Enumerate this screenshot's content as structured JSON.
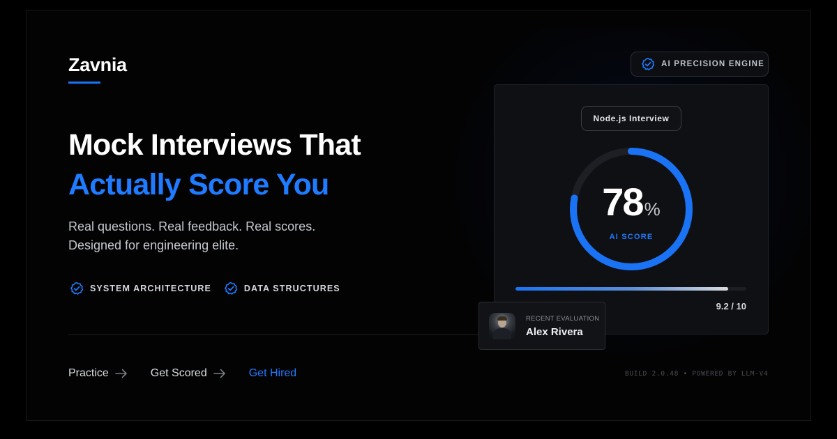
{
  "brand": {
    "name": "Zavnia",
    "accent_color": "#1f7bff"
  },
  "hero": {
    "headline_line1": "Mock Interviews That",
    "headline_line2": "Actually Score You",
    "subtitle_line1": "Real questions. Real feedback. Real scores.",
    "subtitle_line2": "Designed for engineering elite."
  },
  "tags": [
    {
      "label": "SYSTEM ARCHITECTURE",
      "icon": "check-badge-icon"
    },
    {
      "label": "DATA STRUCTURES",
      "icon": "check-badge-icon"
    }
  ],
  "steps": [
    {
      "label": "Practice",
      "icon": "arrow-right-icon"
    },
    {
      "label": "Get Scored",
      "icon": "arrow-right-icon"
    },
    {
      "label": "Get Hired",
      "active": true
    }
  ],
  "footer": {
    "build": "BUILD 2.0.48 • POWERED BY LLM-V4"
  },
  "engine_badge": {
    "label": "AI PRECISION ENGINE",
    "icon": "verified-badge-icon"
  },
  "score_card": {
    "topic": "Node.js Interview",
    "score": "78",
    "score_unit": "%",
    "score_fraction": 0.78,
    "score_label": "AI SCORE",
    "rating": "9.2 / 10",
    "rating_fraction": 0.92
  },
  "evaluation": {
    "label": "RECENT EVALUATION",
    "name": "Alex Rivera"
  }
}
